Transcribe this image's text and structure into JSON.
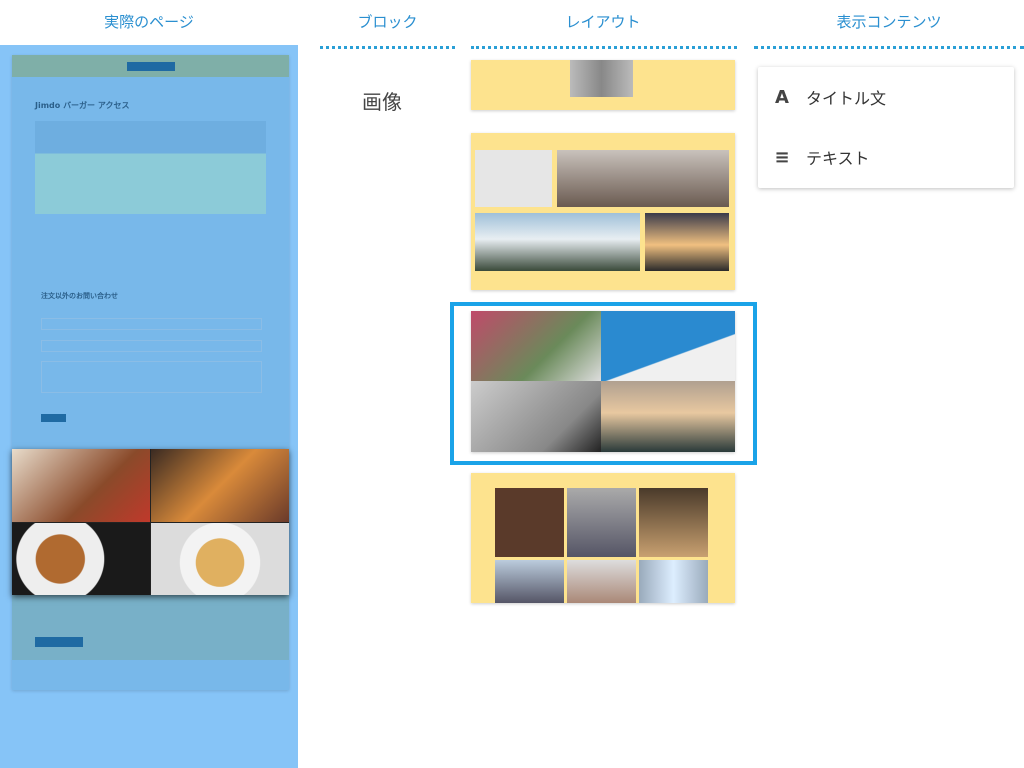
{
  "columns": {
    "actual_page": "実際のページ",
    "block": "ブロック",
    "layout": "レイアウト",
    "content": "表示コンテンツ"
  },
  "block_name": "画像",
  "preview": {
    "title": "Jimdo バーガー アクセス",
    "contact_title": "注文以外のお問い合わせ"
  },
  "content_menu": [
    {
      "icon": "title-icon",
      "label": "タイトル文"
    },
    {
      "icon": "text-lines-icon",
      "label": "テキスト"
    }
  ],
  "colors": {
    "accent": "#2a9fd6",
    "selection": "#1aa3e8",
    "card_bg": "#fde38e",
    "overlay": "#86c4f7"
  }
}
